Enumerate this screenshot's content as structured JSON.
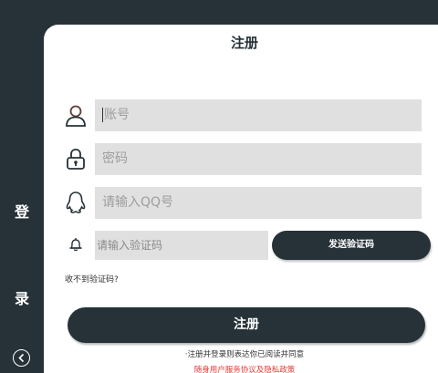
{
  "sidebar": {
    "char_1": "登",
    "char_2": "录",
    "back_icon": "chevron-left-circle-icon"
  },
  "form": {
    "title": "注册",
    "account_placeholder": "账号",
    "password_placeholder": "密码",
    "qq_placeholder": "请输入QQ号",
    "code_placeholder": "请输入验证码",
    "send_code_label": "发送验证码",
    "no_code_link": "收不到验证码?",
    "register_label": "注册",
    "agree_text": "·注册并登录则表达你已阅读并同意",
    "policy_text": "随身用户服务协议及隐私政策"
  },
  "icons": {
    "account": "user-icon",
    "password": "lock-icon",
    "qq": "qq-icon",
    "code": "bell-icon"
  },
  "colors": {
    "dark": "#263238",
    "field_bg": "#e0e0e0",
    "policy_red": "#e53935"
  }
}
